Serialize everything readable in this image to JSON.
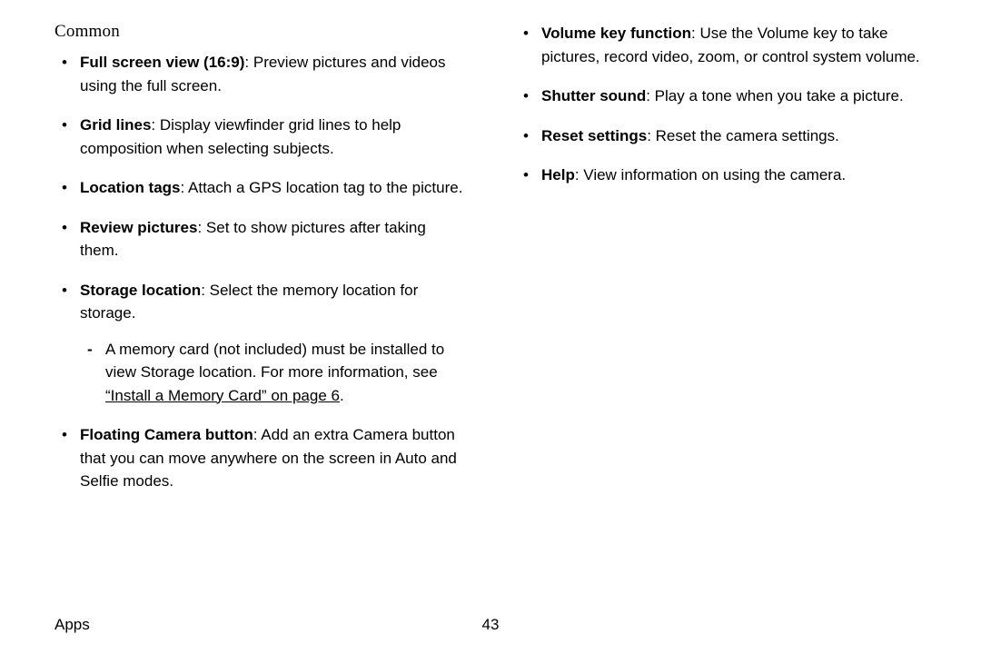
{
  "heading": "Common",
  "left": [
    {
      "term": "Full screen view (16:9)",
      "desc": ": Preview pictures and videos using the full screen."
    },
    {
      "term": "Grid lines",
      "desc": ": Display viewfinder grid lines to help composition when selecting subjects."
    },
    {
      "term": "Location tags",
      "desc": ": Attach a GPS location tag to the picture."
    },
    {
      "term": "Review pictures",
      "desc": ": Set to show pictures after taking them."
    },
    {
      "term": "Storage location",
      "desc": ": Select the memory location for storage.",
      "sub": [
        {
          "pre": "A memory card (not included) must be installed to view Storage location. For more information, see ",
          "link": "“Install a Memory Card” on page 6",
          "post": "."
        }
      ]
    },
    {
      "term": "Floating Camera button",
      "desc": ": Add an extra Camera button that you can move anywhere on the screen in Auto and Selfie modes."
    }
  ],
  "right": [
    {
      "term": "Volume key function",
      "desc": ": Use the Volume key to take pictures, record video, zoom, or control system volume."
    },
    {
      "term": "Shutter sound",
      "desc": ": Play a tone when you take a picture."
    },
    {
      "term": "Reset settings",
      "desc": ": Reset the camera settings."
    },
    {
      "term": "Help",
      "desc": ": View information on using the camera."
    }
  ],
  "footer": {
    "section": "Apps",
    "page": "43"
  }
}
